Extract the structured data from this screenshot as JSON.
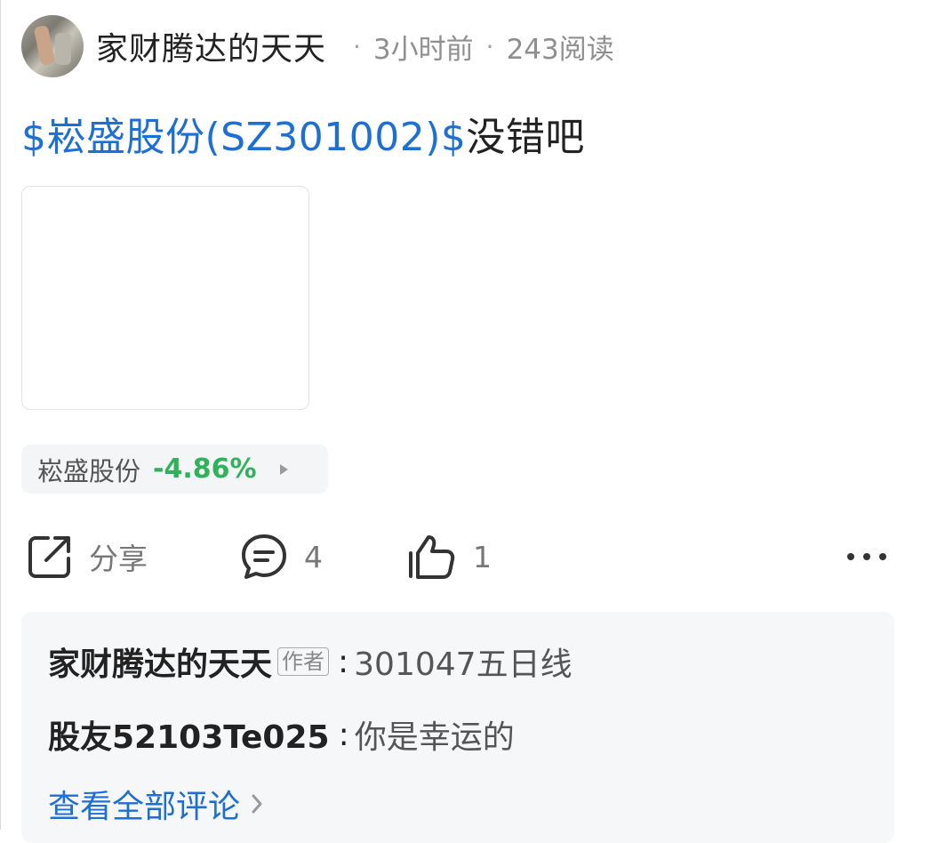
{
  "post": {
    "author": "家财腾达的天天",
    "time": "3小时前",
    "reads": "243阅读",
    "separator": "·",
    "title_link": "$崧盛股份(SZ301002)$",
    "title_text": "没错吧"
  },
  "stock_tag": {
    "name": "崧盛股份",
    "change": "-4.86%",
    "change_color": "#2fb25a"
  },
  "actions": {
    "share_label": "分享",
    "comment_count": "4",
    "like_count": "1"
  },
  "comments": {
    "items": [
      {
        "user": "家财腾达的天天",
        "badge": "作者",
        "colon": ":",
        "text": "301047五日线"
      },
      {
        "user": "股友52103Te025",
        "colon": ":",
        "text": "你是幸运的"
      }
    ],
    "view_all": "查看全部评论"
  },
  "colors": {
    "link_blue": "#1d6fd4",
    "muted_gray": "#8f8f8f",
    "comment_bg": "#f6f7f9"
  },
  "icons": {
    "share": "share-icon",
    "comment": "comment-icon",
    "like": "thumbs-up-icon",
    "more": "more-dots-icon",
    "arrow": "chevron-right-icon"
  }
}
